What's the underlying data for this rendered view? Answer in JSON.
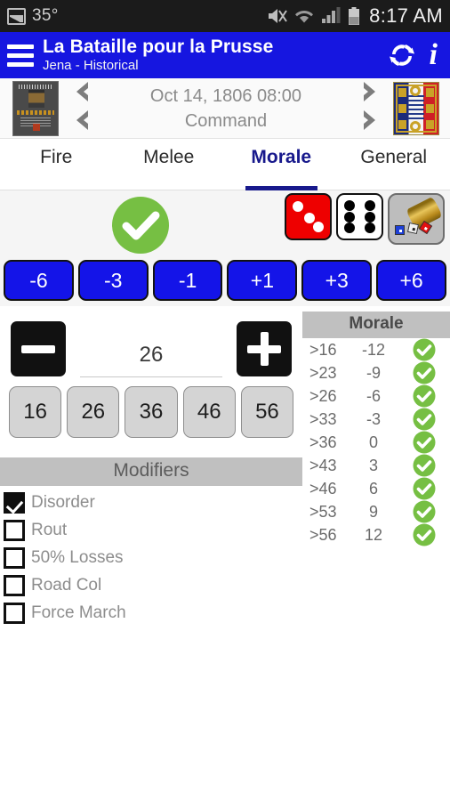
{
  "statusbar": {
    "temperature": "35°",
    "time": "8:17 AM",
    "icons": [
      "picture-icon",
      "mute-icon",
      "wifi-icon",
      "signal-icon",
      "battery-icon"
    ]
  },
  "appbar": {
    "menu_icon": "hamburger-menu-icon",
    "title": "La Bataille pour la Prusse",
    "subtitle": "Jena - Historical",
    "refresh_icon": "refresh-icon",
    "info_icon": "info-icon",
    "background": "#1616e0"
  },
  "datenav": {
    "book_cover_icon": "game-cover-thumbnail",
    "prev_label": "❮",
    "next_label": "❯",
    "date": "Oct 14, 1806 08:00",
    "phase": "Command",
    "flag_icon": "french-eagle-flag"
  },
  "tabs": [
    {
      "label": "Fire",
      "active": false
    },
    {
      "label": "Melee",
      "active": false
    },
    {
      "label": "Morale",
      "active": true
    },
    {
      "label": "General",
      "active": false
    }
  ],
  "tab_accent": "#18198c",
  "result": {
    "status_icon": "green-check-circle-icon",
    "status_color": "#76bf43",
    "red_die": 3,
    "white_die": 6,
    "roll_cup_icon": "dice-cup-icon"
  },
  "adjust_buttons": [
    {
      "label": "-6"
    },
    {
      "label": "-3"
    },
    {
      "label": "-1"
    },
    {
      "label": "+1"
    },
    {
      "label": "+3"
    },
    {
      "label": "+6"
    }
  ],
  "adjust_color": "#1414e8",
  "stepper": {
    "minus_icon": "minus-icon",
    "plus_icon": "plus-icon",
    "value": "26"
  },
  "quick_values": [
    "16",
    "26",
    "36",
    "46",
    "56"
  ],
  "modifiers": {
    "title": "Modifiers",
    "items": [
      {
        "label": "Disorder",
        "checked": true
      },
      {
        "label": "Rout",
        "checked": false
      },
      {
        "label": "50% Losses",
        "checked": false
      },
      {
        "label": "Road Col",
        "checked": false
      },
      {
        "label": "Force March",
        "checked": false
      }
    ]
  },
  "morale_table": {
    "title": "Morale",
    "rows": [
      {
        "threshold": ">16",
        "modifier": "-12",
        "result_icon": "green-check-icon"
      },
      {
        "threshold": ">23",
        "modifier": "-9",
        "result_icon": "green-check-icon"
      },
      {
        "threshold": ">26",
        "modifier": "-6",
        "result_icon": "green-check-icon"
      },
      {
        "threshold": ">33",
        "modifier": "-3",
        "result_icon": "green-check-icon"
      },
      {
        "threshold": ">36",
        "modifier": "0",
        "result_icon": "green-check-icon"
      },
      {
        "threshold": ">43",
        "modifier": "3",
        "result_icon": "green-check-icon"
      },
      {
        "threshold": ">46",
        "modifier": "6",
        "result_icon": "green-check-icon"
      },
      {
        "threshold": ">53",
        "modifier": "9",
        "result_icon": "green-check-icon"
      },
      {
        "threshold": ">56",
        "modifier": "12",
        "result_icon": "green-check-icon"
      }
    ]
  }
}
